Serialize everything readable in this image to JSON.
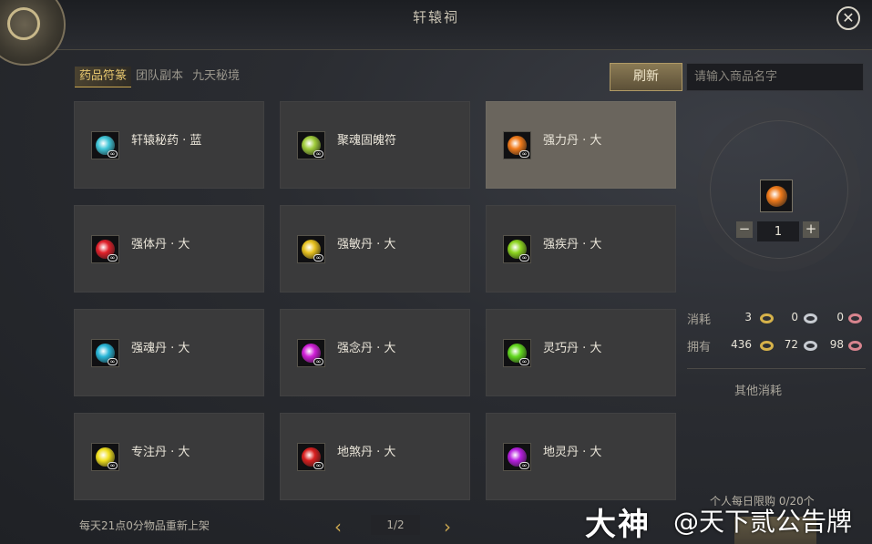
{
  "window": {
    "title": "轩辕祠"
  },
  "tabs": [
    {
      "label": "药品符篆",
      "active": true
    },
    {
      "label": "团队副本",
      "active": false
    },
    {
      "label": "九天秘境",
      "active": false
    }
  ],
  "toolbar": {
    "refresh_label": "刷新",
    "search_placeholder": "请输入商品名字"
  },
  "items": [
    {
      "name": "轩辕秘药 · 蓝",
      "color": "#3fc6d8",
      "selected": false
    },
    {
      "name": "聚魂固魄符",
      "color": "#9fcc3a",
      "selected": false
    },
    {
      "name": "强力丹 · 大",
      "color": "#f07a1a",
      "selected": true
    },
    {
      "name": "强体丹 · 大",
      "color": "#e0202a",
      "selected": false
    },
    {
      "name": "强敏丹 · 大",
      "color": "#e8c21e",
      "selected": false
    },
    {
      "name": "强疾丹 · 大",
      "color": "#8cd41e",
      "selected": false
    },
    {
      "name": "强魂丹 · 大",
      "color": "#28b6d8",
      "selected": false
    },
    {
      "name": "强念丹 · 大",
      "color": "#d01ed8",
      "selected": false
    },
    {
      "name": "灵巧丹 · 大",
      "color": "#62d81e",
      "selected": false
    },
    {
      "name": "专注丹 · 大",
      "color": "#f0e01e",
      "selected": false
    },
    {
      "name": "地煞丹 · 大",
      "color": "#d81e1e",
      "selected": false
    },
    {
      "name": "地灵丹 · 大",
      "color": "#b61ee0",
      "selected": false
    }
  ],
  "badge_symbol": "∞",
  "detail": {
    "icon_color": "#f07a1a",
    "quantity": "1",
    "minus": "−",
    "plus": "+",
    "cost_label": "消耗",
    "cost": [
      "3",
      "0",
      "0"
    ],
    "own_label": "拥有",
    "own": [
      "436",
      "72",
      "98"
    ],
    "other_cost_label": "其他消耗",
    "daily_limit": "个人每日限购 0/20个"
  },
  "footer": {
    "restock_text": "每天21点0分物品重新上架",
    "page": "1/2",
    "prev": "‹",
    "next": "›"
  },
  "watermark": {
    "brand": "大神",
    "account": "@天下贰公告牌"
  },
  "close_symbol": "✕"
}
